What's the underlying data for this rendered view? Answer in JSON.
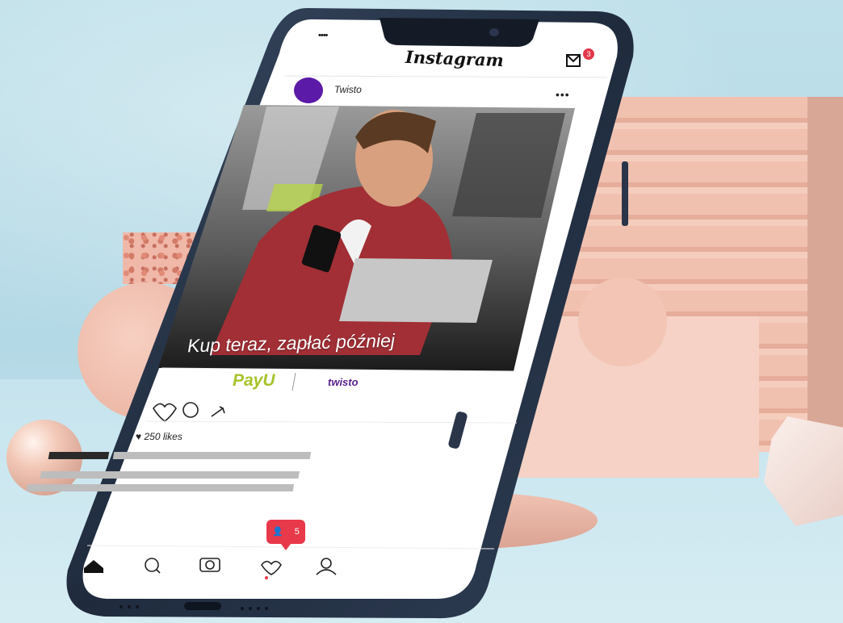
{
  "status_bar": {
    "left": "••••"
  },
  "header": {
    "title": "Instagram",
    "dm_badge_count": "3"
  },
  "post": {
    "username": "Twisto",
    "more_label": "•••",
    "headline": "Kup teraz, zapłać później",
    "brand_left": "PayU",
    "brand_right": "twisto",
    "likes": "250 likes"
  },
  "notification": {
    "count": "5"
  },
  "nav": {
    "items": [
      "home-icon",
      "search-icon",
      "camera-icon",
      "heart-icon",
      "profile-icon"
    ]
  },
  "colors": {
    "accent_red": "#e8394a",
    "avatar_purple": "#5b1aa8",
    "payu_green": "#a6c32a",
    "twisto_purple": "#5a2290"
  }
}
